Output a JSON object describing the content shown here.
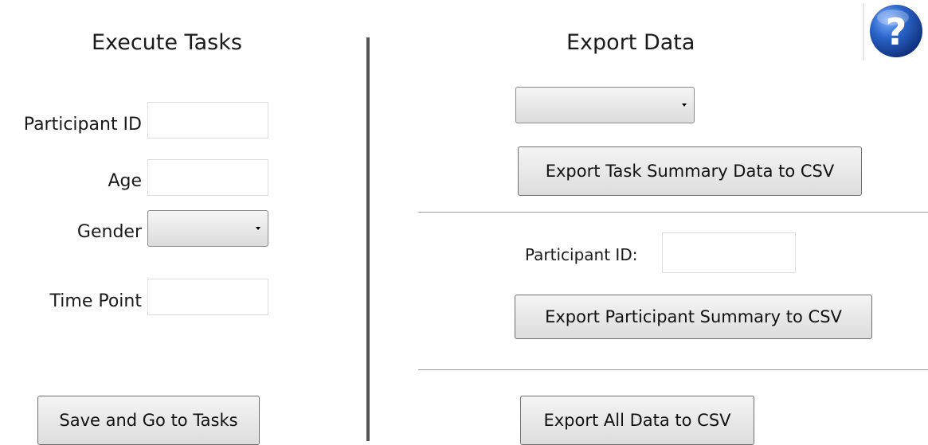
{
  "execute": {
    "heading": "Execute Tasks",
    "participant_id_label": "Participant ID",
    "participant_id_value": "",
    "age_label": "Age",
    "age_value": "",
    "gender_label": "Gender",
    "gender_value": "",
    "time_point_label": "Time Point",
    "time_point_value": "",
    "save_button": "Save and Go to Tasks"
  },
  "export": {
    "heading": "Export Data",
    "task_select_value": "",
    "task_summary_button": "Export Task Summary Data to CSV",
    "participant_id_label": "Participant ID:",
    "participant_id_value": "",
    "participant_summary_button": "Export Participant Summary to CSV",
    "all_data_button": "Export All Data to CSV"
  },
  "help": {
    "icon": "help-question-icon",
    "color": "#1f4fa8"
  }
}
